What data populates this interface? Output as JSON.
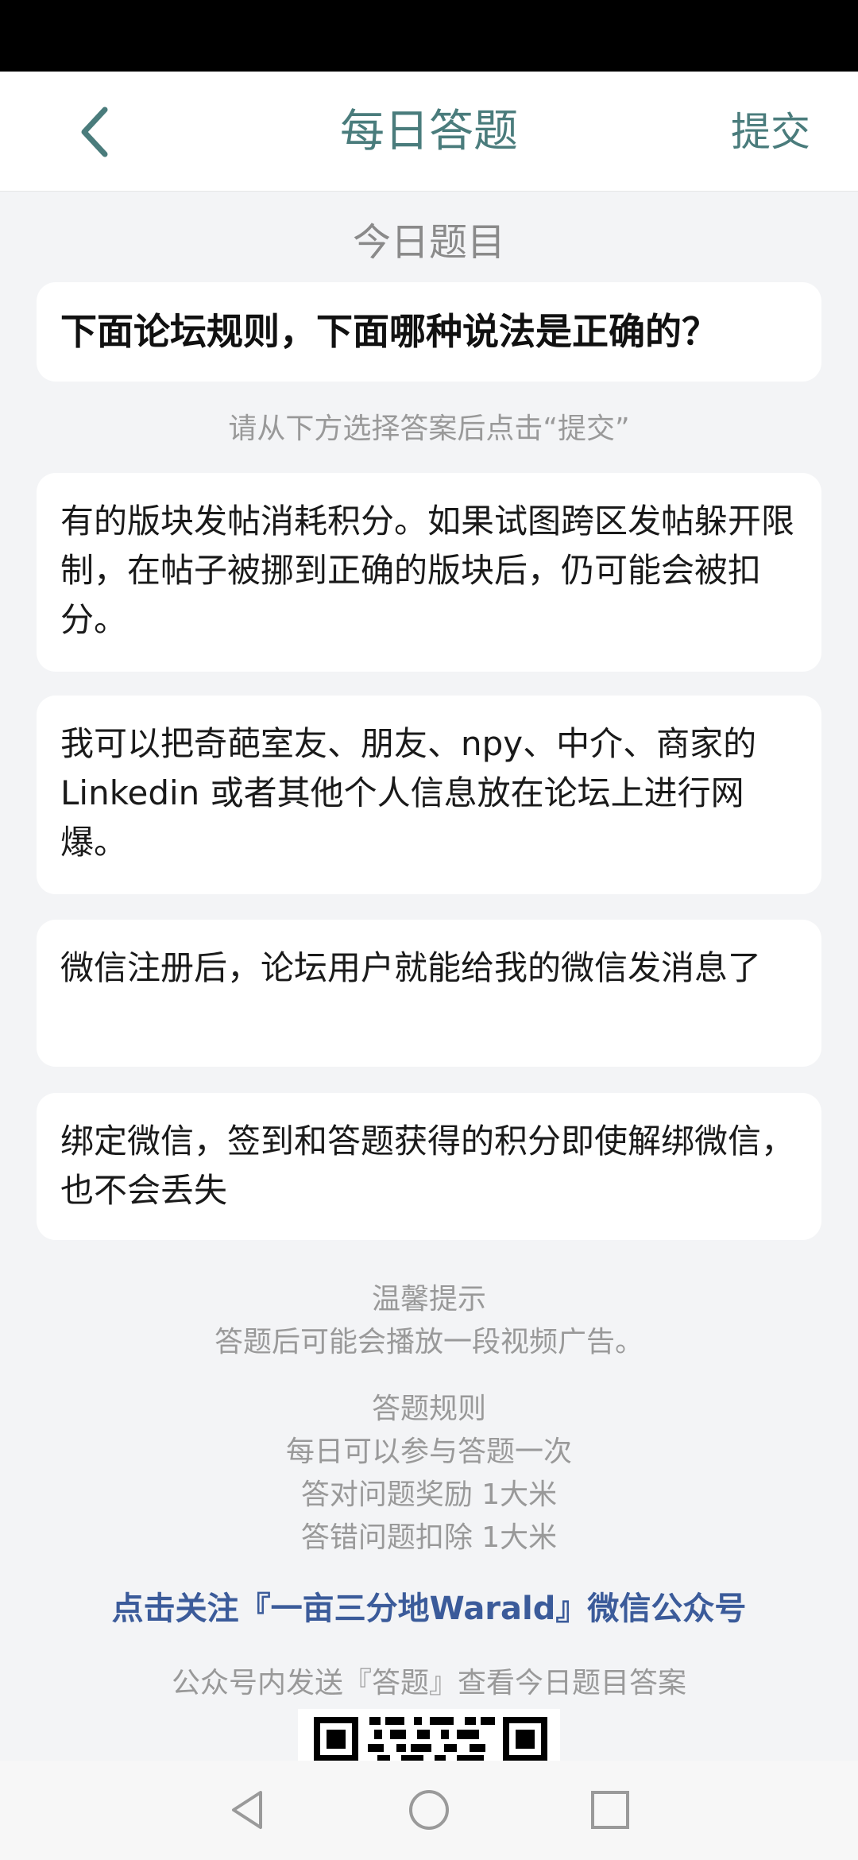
{
  "header": {
    "title": "每日答题",
    "submit_label": "提交"
  },
  "section_title": "今日题目",
  "question": "下面论坛规则，下面哪种说法是正确的？",
  "instruction": "请从下方选择答案后点击“提交”",
  "options": [
    {
      "label": "有的版块发帖消耗积分。如果试图跨区发帖躲开限制，在帖子被挪到正确的版块后，仍可能会被扣分。"
    },
    {
      "label": "我可以把奇葩室友、朋友、npy、中介、商家的 Linkedin 或者其他个人信息放在论坛上进行网爆。"
    },
    {
      "label": "微信注册后，论坛用户就能给我的微信发消息了"
    },
    {
      "label": "绑定微信，签到和答题获得的积分即使解绑微信，也不会丢失"
    }
  ],
  "tips": {
    "title": "温馨提示",
    "text": "答题后可能会播放一段视频广告。"
  },
  "rules": {
    "title": "答题规则",
    "line1": "每日可以参与答题一次",
    "line2": "答对问题奖励 1大米",
    "line3": "答错问题扣除 1大米"
  },
  "follow_link": "点击关注『一亩三分地Warald』微信公众号",
  "wechat_hint": "公众号内发送『答题』查看今日题目答案",
  "colors": {
    "accent": "#4a7c7c",
    "link": "#3b5b9a",
    "background": "#f3f4f6"
  },
  "icons": {
    "back": "chevron-left-icon",
    "nav_back": "triangle-back-icon",
    "nav_home": "circle-home-icon",
    "nav_recent": "square-recents-icon"
  }
}
